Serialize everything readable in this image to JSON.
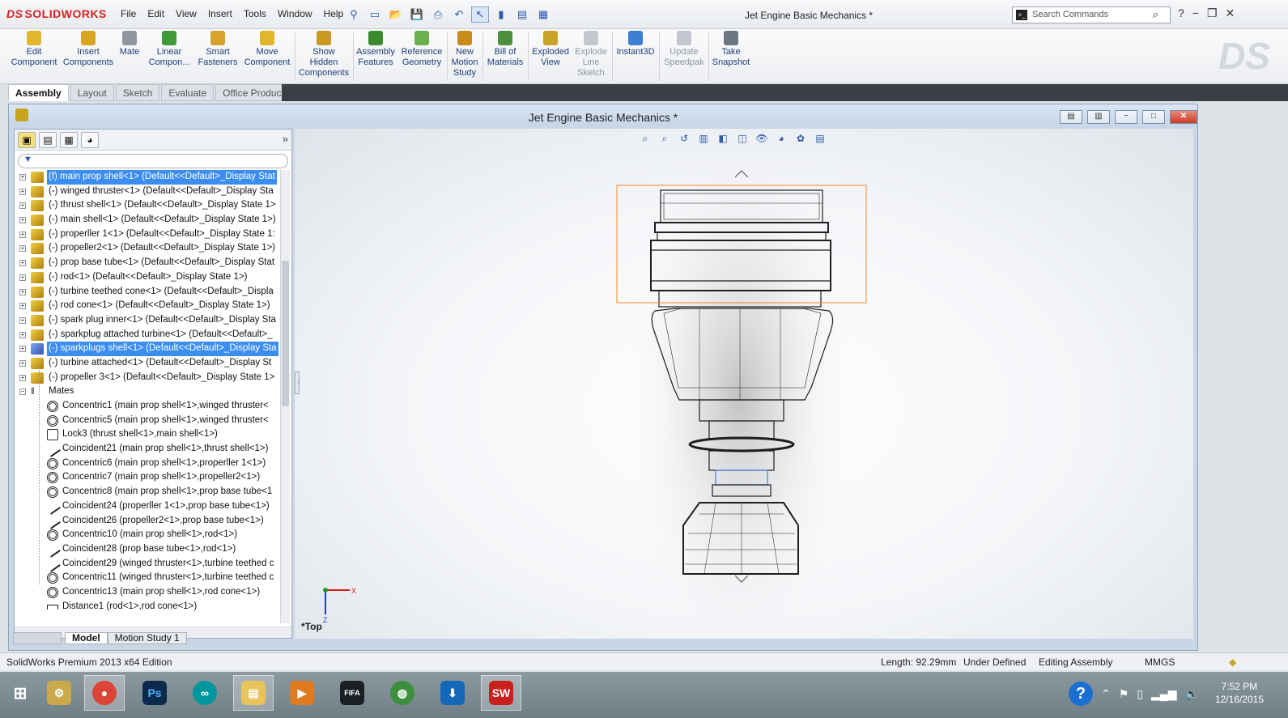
{
  "app": {
    "logo": "SOLIDWORKS",
    "menus": [
      "File",
      "Edit",
      "View",
      "Insert",
      "Tools",
      "Window",
      "Help"
    ],
    "document_title": "Jet Engine Basic Mechanics *",
    "search_placeholder": "Search Commands"
  },
  "command_manager": [
    {
      "label": "Edit\nComponent",
      "enabled": true
    },
    {
      "label": "Insert\nComponents",
      "enabled": true
    },
    {
      "label": "Mate",
      "enabled": true
    },
    {
      "label": "Linear\nCompon...",
      "enabled": true
    },
    {
      "label": "Smart\nFasteners",
      "enabled": true
    },
    {
      "label": "Move\nComponent",
      "enabled": true
    },
    {
      "label": "Show\nHidden\nComponents",
      "enabled": true
    },
    {
      "label": "Assembly\nFeatures",
      "enabled": true
    },
    {
      "label": "Reference\nGeometry",
      "enabled": true
    },
    {
      "label": "New\nMotion\nStudy",
      "enabled": true
    },
    {
      "label": "Bill of\nMaterials",
      "enabled": true
    },
    {
      "label": "Exploded\nView",
      "enabled": true
    },
    {
      "label": "Explode\nLine\nSketch",
      "enabled": false
    },
    {
      "label": "Instant3D",
      "enabled": true
    },
    {
      "label": "Update\nSpeedpak",
      "enabled": false
    },
    {
      "label": "Take\nSnapshot",
      "enabled": true
    }
  ],
  "tabs": [
    "Assembly",
    "Layout",
    "Sketch",
    "Evaluate",
    "Office Products"
  ],
  "doc_window": {
    "title": "Jet Engine Basic Mechanics *"
  },
  "tree": {
    "components": [
      {
        "label": "(f) main prop shell<1> (Default<<Default>_Display Stat",
        "selected": true,
        "icon": "yellow"
      },
      {
        "label": "(-) winged thruster<1> (Default<<Default>_Display Sta",
        "selected": false,
        "icon": "yellow"
      },
      {
        "label": "(-) thrust shell<1> (Default<<Default>_Display State 1>",
        "selected": false,
        "icon": "yellow"
      },
      {
        "label": "(-) main shell<1> (Default<<Default>_Display State 1>)",
        "selected": false,
        "icon": "yellow"
      },
      {
        "label": "(-) properller 1<1> (Default<<Default>_Display State 1:",
        "selected": false,
        "icon": "yellow"
      },
      {
        "label": "(-) propeller2<1> (Default<<Default>_Display State 1>)",
        "selected": false,
        "icon": "yellow"
      },
      {
        "label": "(-) prop base tube<1> (Default<<Default>_Display Stat",
        "selected": false,
        "icon": "yellow"
      },
      {
        "label": "(-) rod<1> (Default<<Default>_Display State 1>)",
        "selected": false,
        "icon": "yellow"
      },
      {
        "label": "(-) turbine teethed cone<1> (Default<<Default>_Displa",
        "selected": false,
        "icon": "yellow"
      },
      {
        "label": "(-) rod cone<1> (Default<<Default>_Display State 1>)",
        "selected": false,
        "icon": "yellow"
      },
      {
        "label": "(-) spark plug inner<1> (Default<<Default>_Display Sta",
        "selected": false,
        "icon": "yellow"
      },
      {
        "label": "(-) sparkplug attached turbine<1> (Default<<Default>_",
        "selected": false,
        "icon": "yellow"
      },
      {
        "label": "(-) sparkplugs shell<1> (Default<<Default>_Display Sta",
        "selected": true,
        "icon": "blue"
      },
      {
        "label": "(-) turbine attached<1> (Default<<Default>_Display St",
        "selected": false,
        "icon": "yellow"
      },
      {
        "label": "(-) propeller 3<1> (Default<<Default>_Display State 1>",
        "selected": false,
        "icon": "yellow"
      }
    ],
    "mates_folder": "Mates",
    "mates": [
      {
        "label": "Concentric1 (main prop shell<1>,winged thruster<",
        "type": "concentric"
      },
      {
        "label": "Concentric5 (main prop shell<1>,winged thruster<",
        "type": "concentric"
      },
      {
        "label": "Lock3 (thrust shell<1>,main shell<1>)",
        "type": "lock"
      },
      {
        "label": "Coincident21 (main prop shell<1>,thrust shell<1>)",
        "type": "coincident"
      },
      {
        "label": "Concentric6 (main prop shell<1>,properller 1<1>)",
        "type": "concentric"
      },
      {
        "label": "Concentric7 (main prop shell<1>,propeller2<1>)",
        "type": "concentric"
      },
      {
        "label": "Concentric8 (main prop shell<1>,prop base tube<1",
        "type": "concentric"
      },
      {
        "label": "Coincident24 (properller 1<1>,prop base tube<1>)",
        "type": "coincident"
      },
      {
        "label": "Coincident26 (propeller2<1>,prop base tube<1>)",
        "type": "coincident"
      },
      {
        "label": "Concentric10 (main prop shell<1>,rod<1>)",
        "type": "concentric"
      },
      {
        "label": "Coincident28 (prop base tube<1>,rod<1>)",
        "type": "coincident"
      },
      {
        "label": "Coincident29 (winged thruster<1>,turbine teethed c",
        "type": "coincident"
      },
      {
        "label": "Concentric11 (winged thruster<1>,turbine teethed c",
        "type": "concentric"
      },
      {
        "label": "Concentric13 (main prop shell<1>,rod cone<1>)",
        "type": "concentric"
      },
      {
        "label": "Distance1 (rod<1>,rod cone<1>)",
        "type": "distance"
      }
    ]
  },
  "graphics": {
    "view_label": "*Top",
    "triad_x": "X",
    "triad_z": "Z"
  },
  "model_tabs": [
    "Model",
    "Motion Study 1"
  ],
  "status": {
    "edition": "SolidWorks Premium 2013 x64 Edition",
    "length": "Length: 92.29mm",
    "definition": "Under Defined",
    "mode": "Editing Assembly",
    "units": "MMGS"
  },
  "taskbar": {
    "time": "7:52 PM",
    "date": "12/16/2015",
    "apps": [
      "file-explorer",
      "chrome",
      "photoshop",
      "arduino",
      "folder",
      "media-player",
      "fifa",
      "globe",
      "download",
      "solidworks"
    ]
  },
  "colors": {
    "selection": "#3b8ef0",
    "brand": "#d8201e",
    "close": "#c93c26"
  }
}
